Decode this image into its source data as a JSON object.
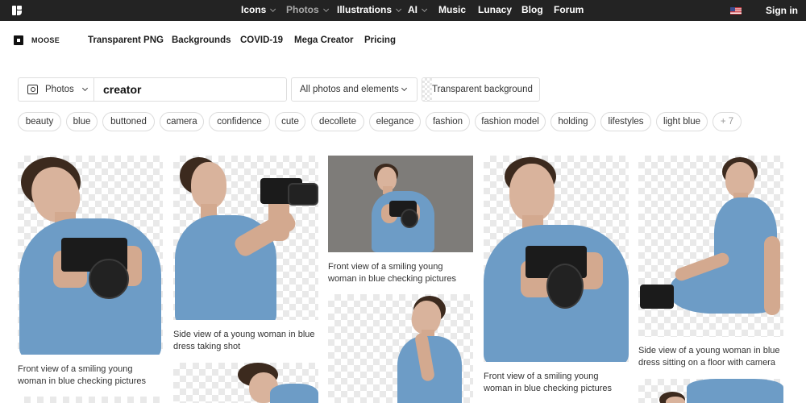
{
  "topbar": {
    "nav": [
      {
        "label": "Icons",
        "has_dropdown": true,
        "active": false
      },
      {
        "label": "Photos",
        "has_dropdown": true,
        "active": true
      },
      {
        "label": "Illustrations",
        "has_dropdown": true,
        "active": false
      },
      {
        "label": "AI",
        "has_dropdown": true,
        "active": false
      },
      {
        "label": "Music",
        "has_dropdown": false,
        "active": false
      },
      {
        "label": "Lunacy",
        "has_dropdown": false,
        "active": false
      },
      {
        "label": "Blog",
        "has_dropdown": false,
        "active": false
      },
      {
        "label": "Forum",
        "has_dropdown": false,
        "active": false
      }
    ],
    "language_flag": "us-flag-icon",
    "signin_label": "Sign in"
  },
  "subnav": {
    "brand": "MOOSE",
    "items": [
      "Transparent PNG",
      "Backgrounds",
      "COVID-19",
      "Mega Creator",
      "Pricing"
    ]
  },
  "search": {
    "type_label": "Photos",
    "query": "creator",
    "filter_label": "All photos and elements",
    "transparent_label": "Transparent background"
  },
  "tags": [
    "beauty",
    "blue",
    "buttoned",
    "camera",
    "confidence",
    "cute",
    "decollete",
    "elegance",
    "fashion",
    "fashion model",
    "holding",
    "lifestyles",
    "light blue",
    "+ 7"
  ],
  "results": [
    {
      "caption": "Front view of a smiling young woman in blue checking pictures",
      "background": "transparent"
    },
    {
      "caption": "Side view of a young woman in blue dress taking shot",
      "background": "transparent"
    },
    {
      "caption": "Front view of a smiling young woman in blue checking pictures",
      "background": "gray"
    },
    {
      "caption": "Front view of a smiling young woman in blue checking pictures",
      "background": "transparent"
    },
    {
      "caption": "Side view of a young woman in blue dress sitting on a floor with camera",
      "background": "transparent"
    }
  ],
  "colors": {
    "topbar_bg": "#232323",
    "dress_blue": "#6d9cc6",
    "gray_backdrop": "#7e7c79"
  }
}
